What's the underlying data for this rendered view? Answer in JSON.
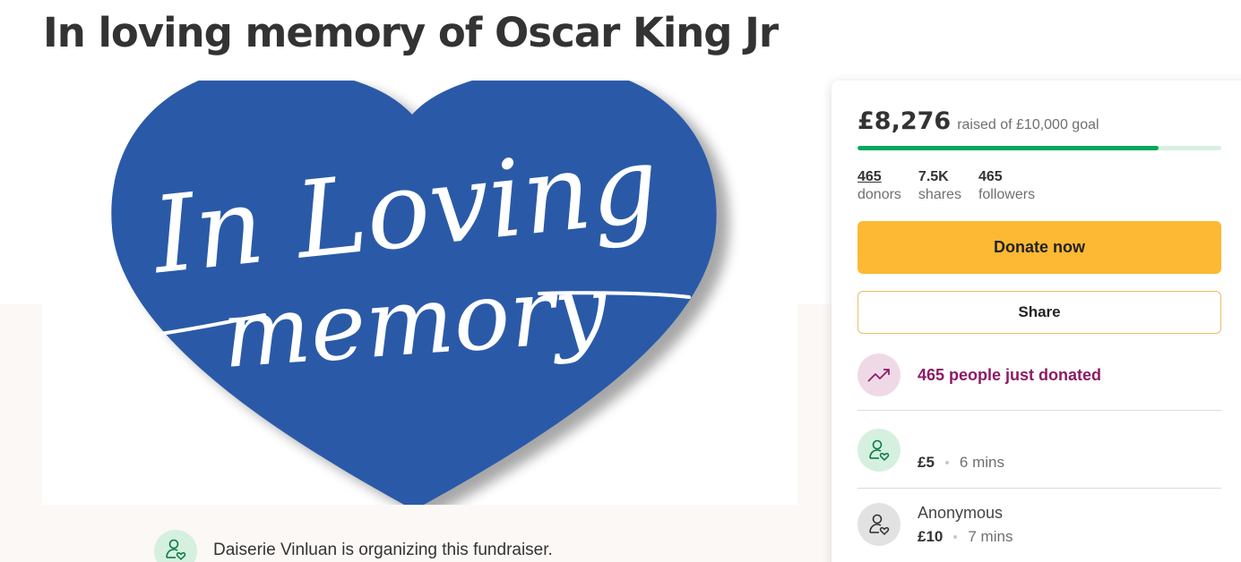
{
  "page": {
    "title": "In loving memory of Oscar King Jr"
  },
  "hero": {
    "image_text_line1": "In Loving",
    "image_text_line2": "memory",
    "heart_color": "#2b5aa7"
  },
  "organizer": {
    "text": "Daiserie Vinluan is organizing this fundraiser.",
    "icon": "user-heart-icon"
  },
  "sidebar": {
    "amount_raised": "£8,276",
    "goal_text": "raised of £10,000 goal",
    "progress_fraction": 0.8276,
    "stats": [
      {
        "value": "465",
        "label": "donors"
      },
      {
        "value": "7.5K",
        "label": "shares"
      },
      {
        "value": "465",
        "label": "followers"
      }
    ],
    "donate_label": "Donate now",
    "share_label": "Share",
    "trend_text": "465 people just donated",
    "donations": [
      {
        "name": "",
        "amount": "£5",
        "time": "6 mins"
      },
      {
        "name": "Anonymous",
        "amount": "£10",
        "time": "7 mins"
      }
    ]
  },
  "colors": {
    "accent_green": "#02a95c",
    "donate_yellow": "#fdb933",
    "trend_purple": "#8c1b66"
  }
}
